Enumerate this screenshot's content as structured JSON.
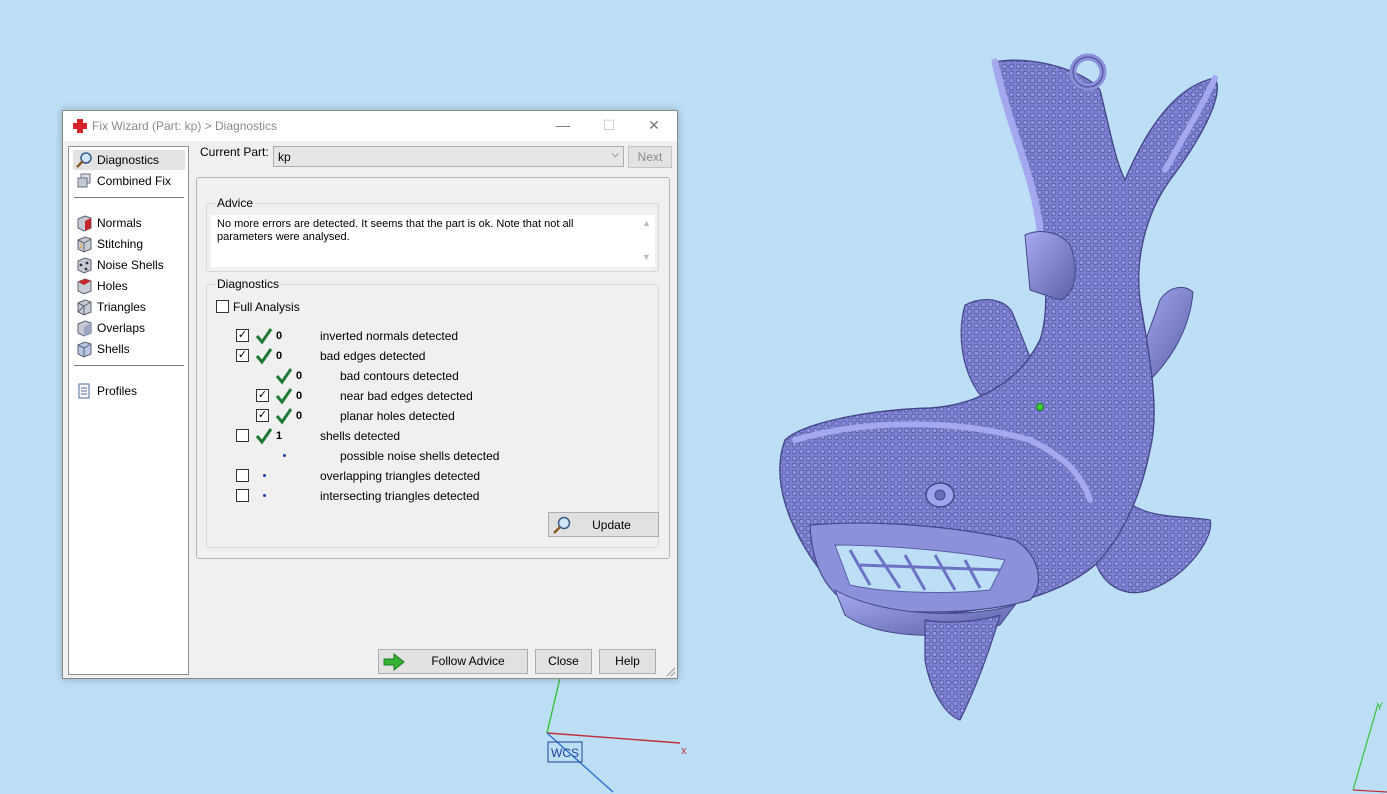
{
  "colors": {
    "background": "#bcdff6",
    "model": "#7b7fcf",
    "model_dark": "#4d4f93",
    "check_green": "#1e7a35"
  },
  "dialog": {
    "title": "Fix Wizard (Part: kp) > Diagnostics",
    "window_buttons": {
      "minimize": "—",
      "maximize": "☐",
      "close": "✕"
    },
    "nav": {
      "items": [
        {
          "label": "Diagnostics",
          "icon": "magnifier-icon"
        },
        {
          "label": "Combined Fix",
          "icon": "combined-fix-icon"
        },
        {
          "label": "Normals",
          "icon": "normals-cube-icon"
        },
        {
          "label": "Stitching",
          "icon": "stitching-cube-icon"
        },
        {
          "label": "Noise Shells",
          "icon": "noise-shells-cube-icon"
        },
        {
          "label": "Holes",
          "icon": "holes-cube-icon"
        },
        {
          "label": "Triangles",
          "icon": "triangles-cube-icon"
        },
        {
          "label": "Overlaps",
          "icon": "overlaps-cube-icon"
        },
        {
          "label": "Shells",
          "icon": "shells-cube-icon"
        },
        {
          "label": "Profiles",
          "icon": "profiles-document-icon"
        }
      ]
    },
    "current_part_label": "Current Part:",
    "current_part_value": "kp",
    "next_label": "Next",
    "advice": {
      "title": "Advice",
      "text": "No more errors are detected. It seems that the part is ok. Note that not all parameters were analysed."
    },
    "diagnostics": {
      "title": "Diagnostics",
      "full_analysis_label": "Full Analysis",
      "full_analysis_checked": false,
      "rows": [
        {
          "checked": true,
          "status": "ok",
          "count": "0",
          "label": "inverted normals detected"
        },
        {
          "checked": true,
          "status": "ok",
          "count": "0",
          "label": "bad edges detected"
        },
        {
          "checked": null,
          "status": "ok",
          "count": "0",
          "label": "bad contours detected"
        },
        {
          "checked": true,
          "status": "ok",
          "count": "0",
          "label": "near bad edges detected"
        },
        {
          "checked": true,
          "status": "ok",
          "count": "0",
          "label": "planar holes detected"
        },
        {
          "checked": false,
          "status": "ok",
          "count": "1",
          "label": "shells detected"
        },
        {
          "checked": null,
          "status": "not-analysed",
          "count": "",
          "label": "possible noise shells detected"
        },
        {
          "checked": false,
          "status": "not-analysed",
          "count": "",
          "label": "overlapping triangles detected"
        },
        {
          "checked": false,
          "status": "not-analysed",
          "count": "",
          "label": "intersecting triangles detected"
        }
      ],
      "update_label": "Update"
    },
    "buttons": {
      "follow_advice": "Follow Advice",
      "close": "Close",
      "help": "Help"
    }
  },
  "viewport": {
    "axis_x_label": "x",
    "axis_y_label": "Y",
    "wcs_label": "WCS"
  }
}
